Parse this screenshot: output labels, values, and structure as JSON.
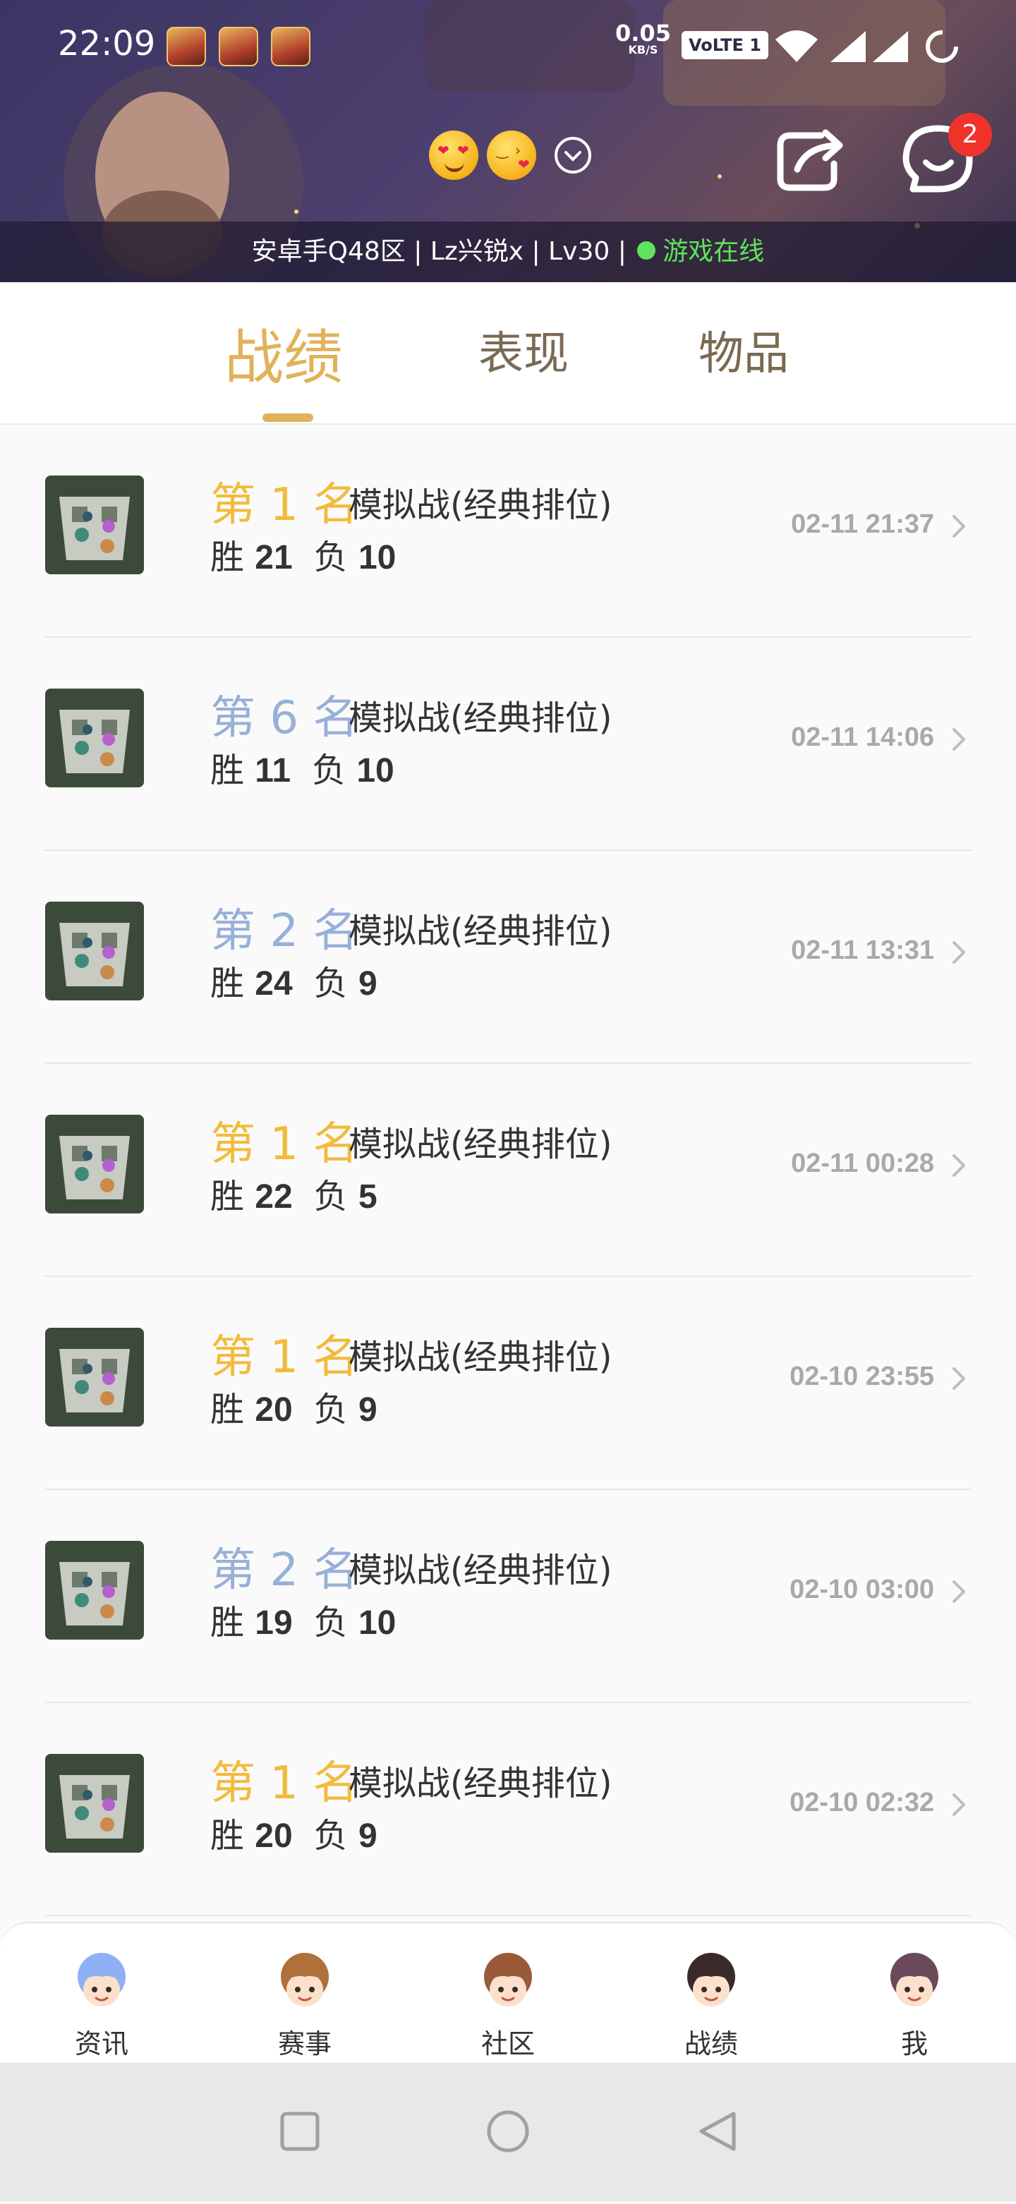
{
  "status_bar": {
    "time": "22:09",
    "net_speed_value": "0.05",
    "net_speed_unit": "KB/S",
    "volte": "VoLTE 1",
    "notification_icons": [
      "game-app-icon",
      "game-app-icon",
      "game-app-icon"
    ],
    "system_icons": [
      "wifi-icon",
      "signal-icon",
      "signal-icon",
      "loading-icon"
    ]
  },
  "header": {
    "emojis": [
      "heart-eyes-emoji",
      "kiss-emoji"
    ],
    "message_badge": "2",
    "info_prefix": "安卓手Q48区 | Lz兴锐x | Lv30 | ",
    "online_status": "游戏在线",
    "online_color": "#5fe35c"
  },
  "tabs": [
    {
      "label": "战绩",
      "active": true
    },
    {
      "label": "表现",
      "active": false
    },
    {
      "label": "物品",
      "active": false
    }
  ],
  "accent_color": "#e0b25a",
  "matches": [
    {
      "rank_prefix": "第",
      "rank": "1",
      "rank_suffix": "名",
      "tier": "gold",
      "mode": "模拟战(经典排位)",
      "win_label": "胜",
      "wins": "21",
      "loss_label": "负",
      "losses": "10",
      "date": "02-11 21:37"
    },
    {
      "rank_prefix": "第",
      "rank": "6",
      "rank_suffix": "名",
      "tier": "blue",
      "mode": "模拟战(经典排位)",
      "win_label": "胜",
      "wins": "11",
      "loss_label": "负",
      "losses": "10",
      "date": "02-11 14:06"
    },
    {
      "rank_prefix": "第",
      "rank": "2",
      "rank_suffix": "名",
      "tier": "blue",
      "mode": "模拟战(经典排位)",
      "win_label": "胜",
      "wins": "24",
      "loss_label": "负",
      "losses": "9",
      "date": "02-11 13:31"
    },
    {
      "rank_prefix": "第",
      "rank": "1",
      "rank_suffix": "名",
      "tier": "gold",
      "mode": "模拟战(经典排位)",
      "win_label": "胜",
      "wins": "22",
      "loss_label": "负",
      "losses": "5",
      "date": "02-11 00:28"
    },
    {
      "rank_prefix": "第",
      "rank": "1",
      "rank_suffix": "名",
      "tier": "gold",
      "mode": "模拟战(经典排位)",
      "win_label": "胜",
      "wins": "20",
      "loss_label": "负",
      "losses": "9",
      "date": "02-10 23:55"
    },
    {
      "rank_prefix": "第",
      "rank": "2",
      "rank_suffix": "名",
      "tier": "blue",
      "mode": "模拟战(经典排位)",
      "win_label": "胜",
      "wins": "19",
      "loss_label": "负",
      "losses": "10",
      "date": "02-10 03:00"
    },
    {
      "rank_prefix": "第",
      "rank": "1",
      "rank_suffix": "名",
      "tier": "gold",
      "mode": "模拟战(经典排位)",
      "win_label": "胜",
      "wins": "20",
      "loss_label": "负",
      "losses": "9",
      "date": "02-10 02:32"
    }
  ],
  "bottom_nav": [
    {
      "label": "资讯",
      "icon": "news-avatar-icon",
      "color": "#8fb0f5"
    },
    {
      "label": "赛事",
      "icon": "events-avatar-icon",
      "color": "#b0703a"
    },
    {
      "label": "社区",
      "icon": "community-avatar-icon",
      "color": "#9a5a3a"
    },
    {
      "label": "战绩",
      "icon": "records-avatar-icon",
      "color": "#3a2a2a"
    },
    {
      "label": "我",
      "icon": "me-avatar-icon",
      "color": "#6a4a5a"
    }
  ],
  "system_nav": [
    "recents-button",
    "home-button",
    "back-button"
  ]
}
